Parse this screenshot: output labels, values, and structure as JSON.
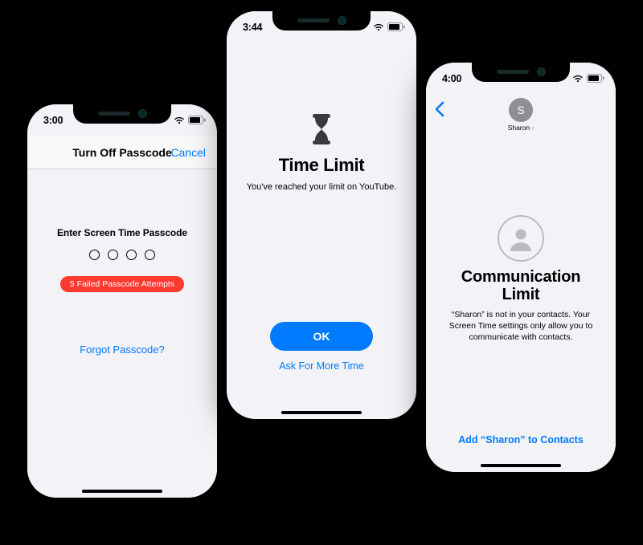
{
  "phone1": {
    "time": "3:00",
    "nav_title": "Turn Off Passcode",
    "cancel": "Cancel",
    "prompt": "Enter Screen Time Passcode",
    "error": "5 Failed Passcode Attempts",
    "forgot": "Forgot Passcode?"
  },
  "phone2": {
    "time": "3:44",
    "heading": "Time Limit",
    "subtitle": "You've reached your limit on YouTube.",
    "ok": "OK",
    "ask": "Ask For More Time"
  },
  "phone3": {
    "time": "4:00",
    "avatar_letter": "S",
    "contact_name": "Sharon",
    "heading_line1": "Communication",
    "heading_line2": "Limit",
    "subtitle": "“Sharon” is not in your contacts. Your Screen Time settings only allow you to communicate with contacts.",
    "add": "Add “Sharon” to Contacts"
  }
}
